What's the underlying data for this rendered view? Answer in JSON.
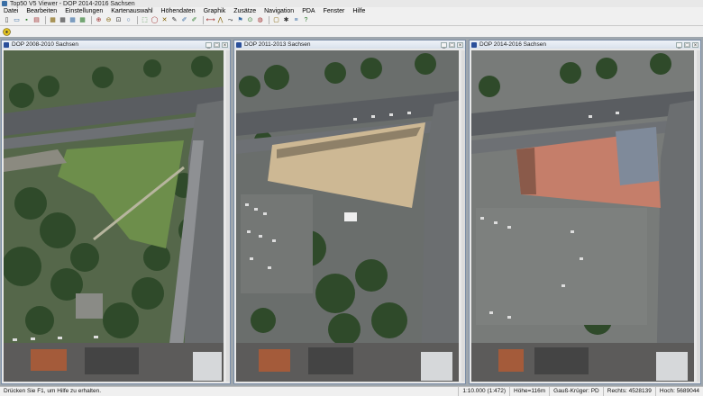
{
  "window": {
    "title": "Top50 V5 Viewer - DOP 2014-2016 Sachsen"
  },
  "menu": [
    "Datei",
    "Bearbeiten",
    "Einstellungen",
    "Kartenauswahl",
    "Höhendaten",
    "Graphik",
    "Zusätze",
    "Navigation",
    "PDA",
    "Fenster",
    "Hilfe"
  ],
  "toolbar_icons": [
    "new-icon",
    "open-icon",
    "save-icon",
    "print-icon",
    "map-icon",
    "map-icon",
    "map-icon",
    "map-icon",
    "zoom-in-icon",
    "zoom-out-icon",
    "zoom-fit-icon",
    "zoom-icon",
    "select-icon",
    "circle-icon",
    "delete-icon",
    "tool-icon",
    "draw-icon",
    "draw-icon",
    "measure-icon",
    "profile-icon",
    "route-icon",
    "flag-icon",
    "gps-icon",
    "globe-icon",
    "pda-icon",
    "wind-icon",
    "layers-icon",
    "help-icon"
  ],
  "maps": [
    {
      "title": "DOP 2008-2010 Sachsen"
    },
    {
      "title": "DOP 2011-2013 Sachsen"
    },
    {
      "title": "DOP 2014-2016 Sachsen"
    }
  ],
  "status": {
    "hint": "Drücken Sie F1, um Hilfe zu erhalten.",
    "scale": "1:10.000   (1:472)",
    "height": "Höhe=116m",
    "crs": "Gauß-Krüger: PD",
    "easting": "Rechts: 4528139",
    "northing": "Hoch: 5689044"
  },
  "colors": {
    "accent": "#2a4f9a",
    "workspace": "#9ea6ad"
  }
}
